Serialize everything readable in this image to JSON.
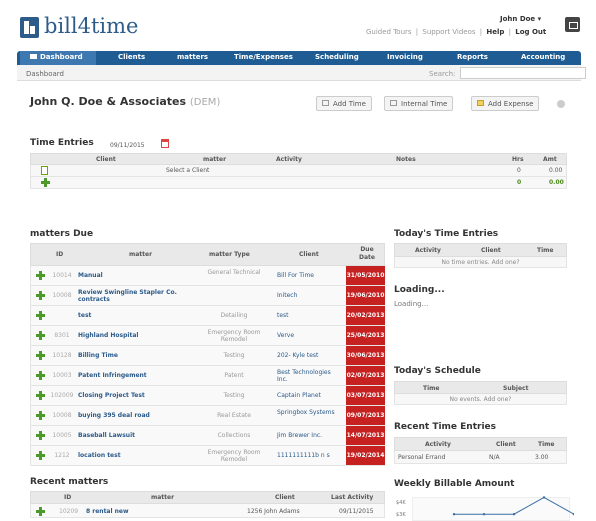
{
  "header": {
    "logo": "bill4time",
    "user_name": "John Doe ▾",
    "link_tours": "Guided Tours",
    "sep": "|",
    "link_videos": "Support Videos",
    "link_help": "Help",
    "link_logout": "Log Out"
  },
  "nav": {
    "items": [
      {
        "label": "Dashboard"
      },
      {
        "label": "Clients"
      },
      {
        "label": "matters"
      },
      {
        "label": "Time/Expenses"
      },
      {
        "label": "Scheduling"
      },
      {
        "label": "Invoicing"
      },
      {
        "label": "Reports"
      },
      {
        "label": "Accounting"
      }
    ],
    "active_color": "#3e78b0",
    "bar_color": "#1f5c93"
  },
  "subbar": {
    "breadcrumb": "Dashboard",
    "search_label": "Search:",
    "search_value": ""
  },
  "company": {
    "name": "John Q. Doe & Associates",
    "code": "(DEM)"
  },
  "actions": {
    "add_time": "Add Time",
    "internal_time": "Internal Time",
    "add_expense": "Add Expense"
  },
  "time_entries": {
    "title": "Time Entries",
    "date": "09/11/2015",
    "columns": [
      "Client",
      "matter",
      "Activity",
      "Notes",
      "Hrs",
      "Amt"
    ],
    "row": {
      "matter_placeholder": "Select a Client",
      "hrs": "0",
      "amt": "0.00"
    },
    "totals": {
      "hrs": "0",
      "amt": "0.00"
    }
  },
  "matters_due": {
    "title": "matters Due",
    "columns": [
      "ID",
      "matter",
      "matter Type",
      "Client",
      "Due Date"
    ],
    "rows": [
      {
        "id": "10014",
        "matter": "Manual",
        "type": "General Technical",
        "client": "Bill For Time",
        "due": "31/05/2010"
      },
      {
        "id": "10008",
        "matter": "Review Swingline Stapler Co. contracts",
        "type": "",
        "client": "Initech",
        "due": "19/06/2010"
      },
      {
        "id": "",
        "matter": "test",
        "type": "Detailing",
        "client": "test",
        "due": "20/02/2013"
      },
      {
        "id": "8301",
        "matter": "Highland Hospital",
        "type": "Emergency Room Remodel",
        "client": "Verve",
        "due": "25/04/2013"
      },
      {
        "id": "10128",
        "matter": "Billing Time",
        "type": "Testing",
        "client": "202- Kyle test",
        "due": "30/06/2013"
      },
      {
        "id": "10003",
        "matter": "Patent Infringement",
        "type": "Patent",
        "client": "Best Technologies Inc.",
        "due": "02/07/2013"
      },
      {
        "id": "102009",
        "matter": "Closing Project Test",
        "type": "Testing",
        "client": "Captain Planet",
        "due": "03/07/2013"
      },
      {
        "id": "10008",
        "matter": "buying 395 deal road",
        "type": "Real Estate",
        "client": "Springbox Systems",
        "due": "09/07/2013"
      },
      {
        "id": "10005",
        "matter": "Baseball Lawsuit",
        "type": "Collections",
        "client": "Jim Brewer Inc.",
        "due": "14/07/2013"
      },
      {
        "id": "1212",
        "matter": "location test",
        "type": "Emergency Room Remodel",
        "client": "1111111111b n s",
        "due": "19/02/2014"
      }
    ]
  },
  "todays_time": {
    "title": "Today's Time Entries",
    "columns": [
      "Activity",
      "Client",
      "Time"
    ],
    "empty": "No time entries. Add one?"
  },
  "loading": {
    "title": "Loading...",
    "text": "Loading..."
  },
  "schedule": {
    "title": "Today's Schedule",
    "columns": [
      "Time",
      "Subject"
    ],
    "empty": "No events. Add one?"
  },
  "recent_time": {
    "title": "Recent Time Entries",
    "columns": [
      "Activity",
      "Client",
      "Time"
    ],
    "rows": [
      {
        "activity": "Personal Errand",
        "client": "N/A",
        "time": "3.00"
      }
    ]
  },
  "recent_matters": {
    "title": "Recent matters",
    "columns": [
      "ID",
      "matter",
      "Client",
      "Last Activity"
    ],
    "rows": [
      {
        "id": "10209",
        "matter": "8 rental new",
        "client": "1256 John Adams",
        "last": "09/11/2015"
      }
    ]
  },
  "weekly": {
    "title": "Weekly Billable Amount"
  },
  "chart_data": {
    "type": "line",
    "title": "Weekly Billable Amount",
    "y_ticks": [
      "$4K",
      "$3K"
    ],
    "series": [
      {
        "values": [
          0.2,
          0.2,
          0.2,
          0.9,
          0.2
        ]
      }
    ]
  }
}
